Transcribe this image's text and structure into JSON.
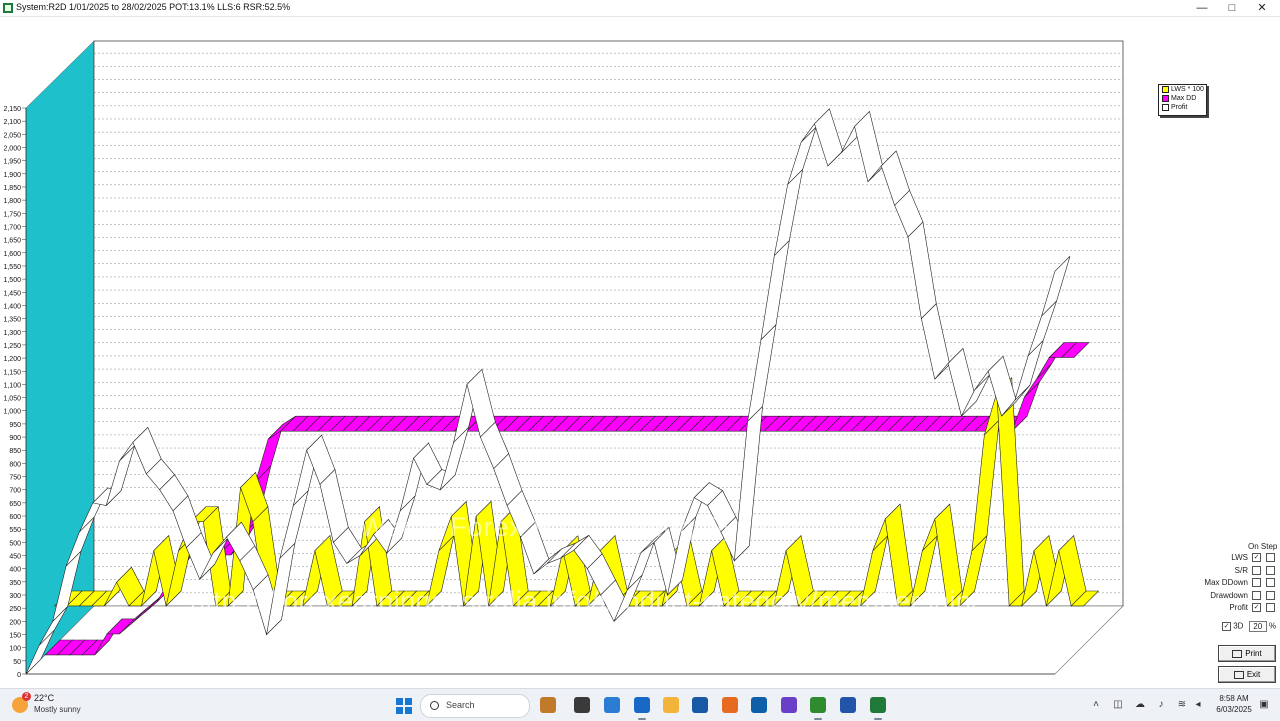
{
  "window": {
    "title": "System:R2D 1/01/2025 to 28/02/2025 POT:13.1% LLS:6 RSR:52.5%",
    "min_glyph": "—",
    "max_glyph": "□",
    "close_glyph": "✕"
  },
  "chart_data": {
    "type": "area",
    "three_d": true,
    "ylim": [
      0,
      2150
    ],
    "y_ticks": [
      "0",
      "50",
      "100",
      "150",
      "200",
      "250",
      "300",
      "350",
      "400",
      "450",
      "500",
      "550",
      "600",
      "650",
      "700",
      "750",
      "800",
      "850",
      "900",
      "950",
      "1,000",
      "1,050",
      "1,100",
      "1,150",
      "1,200",
      "1,250",
      "1,300",
      "1,350",
      "1,400",
      "1,450",
      "1,500",
      "1,550",
      "1,600",
      "1,650",
      "1,700",
      "1,750",
      "1,800",
      "1,850",
      "1,900",
      "1,950",
      "2,000",
      "2,050",
      "2,100",
      "2,150"
    ],
    "grid": true,
    "legend_position": "top-right",
    "colors": {
      "lws": "#ffff00",
      "maxdd": "#ff00ff",
      "profit": "#ffffff",
      "back_wall": "#1ec0cc"
    },
    "series": [
      {
        "name": "LWS * 100",
        "values": [
          150,
          150,
          150,
          150,
          150,
          240,
          150,
          150,
          360,
          150,
          360,
          470,
          470,
          150,
          150,
          600,
          470,
          150,
          150,
          150,
          150,
          360,
          150,
          150,
          150,
          470,
          150,
          150,
          150,
          150,
          150,
          360,
          490,
          150,
          490,
          150,
          470,
          150,
          150,
          150,
          150,
          360,
          150,
          150,
          360,
          150,
          150,
          150,
          150,
          150,
          360,
          150,
          150,
          360,
          150,
          150,
          150,
          150,
          150,
          360,
          150,
          150,
          150,
          150,
          150,
          150,
          360,
          480,
          150,
          150,
          360,
          480,
          150,
          150,
          360,
          800,
          960,
          150,
          150,
          360,
          150,
          360,
          150,
          150
        ]
      },
      {
        "name": "Max DD",
        "values": [
          0,
          0,
          0,
          0,
          0,
          80,
          80,
          120,
          160,
          200,
          280,
          350,
          380,
          380,
          380,
          380,
          460,
          660,
          820,
          850,
          850,
          850,
          850,
          850,
          850,
          850,
          850,
          850,
          850,
          850,
          850,
          850,
          850,
          850,
          850,
          850,
          850,
          850,
          850,
          850,
          850,
          850,
          850,
          850,
          850,
          850,
          850,
          850,
          850,
          850,
          850,
          850,
          850,
          850,
          850,
          850,
          850,
          850,
          850,
          850,
          850,
          850,
          850,
          850,
          850,
          850,
          850,
          850,
          850,
          850,
          850,
          850,
          850,
          850,
          850,
          850,
          850,
          850,
          850,
          980,
          1050,
          1130,
          1130,
          1130
        ]
      },
      {
        "name": "Profit",
        "values": [
          0,
          110,
          200,
          410,
          540,
          650,
          640,
          810,
          880,
          760,
          700,
          620,
          480,
          360,
          460,
          520,
          430,
          320,
          150,
          440,
          640,
          850,
          720,
          500,
          420,
          450,
          530,
          460,
          620,
          820,
          720,
          700,
          880,
          1100,
          900,
          780,
          640,
          520,
          380,
          420,
          440,
          470,
          400,
          300,
          200,
          320,
          460,
          500,
          300,
          540,
          670,
          640,
          540,
          430,
          960,
          1270,
          1590,
          1860,
          2020,
          2090,
          1930,
          1980,
          2080,
          1870,
          1930,
          1780,
          1660,
          1350,
          1120,
          1180,
          980,
          1080,
          1150,
          980,
          1040,
          1210,
          1360,
          1530
        ]
      }
    ]
  },
  "legend": {
    "items": [
      "LWS * 100",
      "Max DD",
      "Profit"
    ]
  },
  "options": {
    "title": "On Step",
    "rows": [
      {
        "label": "LWS",
        "checked1": true,
        "checked2": false
      },
      {
        "label": "S/R",
        "checked1": false,
        "checked2": false
      },
      {
        "label": "Max DDown",
        "checked1": false,
        "checked2": false
      },
      {
        "label": "Drawdown",
        "checked1": false,
        "checked2": false
      },
      {
        "label": "Profit",
        "checked1": true,
        "checked2": false
      }
    ],
    "three_d_label": "3D",
    "three_d_checked": true,
    "depth_value": "20",
    "depth_unit": "%",
    "print_label": "Print",
    "exit_label": "Exit"
  },
  "watermark": {
    "url": "https://forexearningaustralia.info/product-category/membership/",
    "line2": "Wattle Forex R2D Trading System"
  },
  "taskbar": {
    "weather_badge": "2",
    "temperature": "22°C",
    "weather": "Mostly sunny",
    "search_label": "Search",
    "time": "8:58 AM",
    "date": "6/03/2025",
    "icon_names": [
      "widgets-icon",
      "file-explorer-icon",
      "store-icon",
      "outlook-icon",
      "folder-icon",
      "app-l-icon",
      "firefox-icon",
      "calculator-icon",
      "media-icon",
      "gtx-icon",
      "app-icon",
      "trading-app-icon"
    ]
  }
}
